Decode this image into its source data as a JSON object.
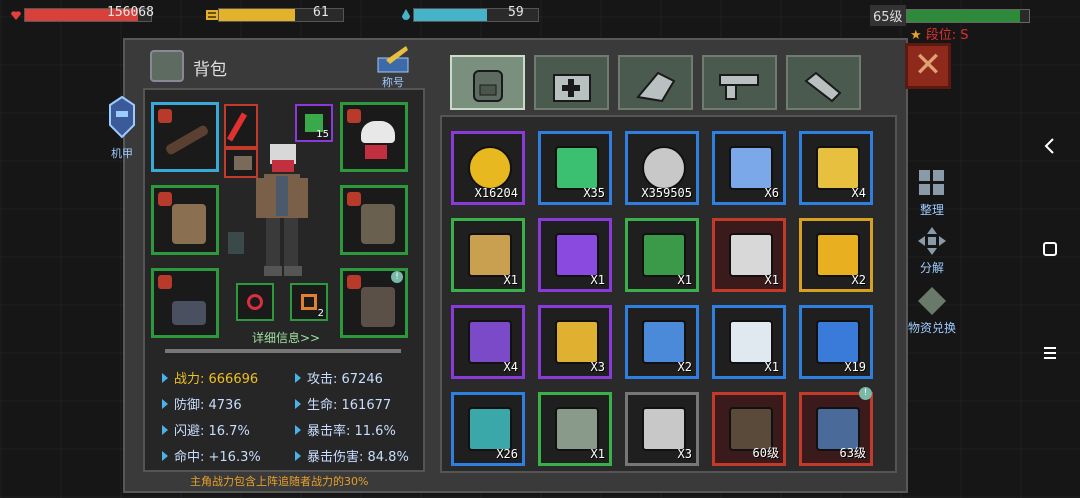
{
  "hud": {
    "hp": "156068",
    "energy": "61",
    "water": "59",
    "level": "65级",
    "rank_label": "段位: S",
    "hp_fraction": 0.9,
    "energy_fraction": 0.61,
    "water_fraction": 0.59,
    "rank_fraction": 0.93
  },
  "panel": {
    "title": "背包",
    "title_badge": "称号",
    "mecha_label": "机甲",
    "detail_link": "详细信息>>",
    "footer_note": "主角战力包含上阵追随者战力的30%"
  },
  "stats": [
    {
      "label": "战力: 666696"
    },
    {
      "label": "攻击: 67246"
    },
    {
      "label": "防御: 4736"
    },
    {
      "label": "生命: 161677"
    },
    {
      "label": "闪避: 16.7%"
    },
    {
      "label": "暴击率: 11.6%"
    },
    {
      "label": "命中: +16.3%"
    },
    {
      "label": "暴击伤害: 84.8%"
    }
  ],
  "tabs": [
    {
      "icon": "backpack-icon"
    },
    {
      "icon": "medkit-icon"
    },
    {
      "icon": "drill-icon"
    },
    {
      "icon": "gun-icon"
    },
    {
      "icon": "wrench-icon"
    }
  ],
  "equipment": {
    "mini_badge_1": "15",
    "mini_badge_2": "2"
  },
  "items": [
    {
      "icon": "gold-coin-icon",
      "count": "X16204",
      "rarity": "purple"
    },
    {
      "icon": "cocktail-icon",
      "count": "X35",
      "rarity": "blue"
    },
    {
      "icon": "silver-coin-icon",
      "count": "X359505",
      "rarity": "blue"
    },
    {
      "icon": "map-icon",
      "count": "X6",
      "rarity": "blue"
    },
    {
      "icon": "exp-card-icon",
      "count": "X4",
      "rarity": "blue"
    },
    {
      "icon": "exp-badge-icon",
      "count": "X1",
      "rarity": "green"
    },
    {
      "icon": "purple-card-icon",
      "count": "X1",
      "rarity": "purple"
    },
    {
      "icon": "green-card-icon",
      "count": "X1",
      "rarity": "green"
    },
    {
      "icon": "red-box-icon",
      "count": "X1",
      "rarity": "red"
    },
    {
      "icon": "gold-box-icon",
      "count": "X2",
      "rarity": "gold"
    },
    {
      "icon": "purple-chest-icon",
      "count": "X4",
      "rarity": "purple"
    },
    {
      "icon": "purple-gold-chest-icon",
      "count": "X3",
      "rarity": "purple"
    },
    {
      "icon": "blue-crate-icon",
      "count": "X2",
      "rarity": "blue"
    },
    {
      "icon": "blue-white-chest-icon",
      "count": "X1",
      "rarity": "blue"
    },
    {
      "icon": "blue-gold-chest-icon",
      "count": "X19",
      "rarity": "blue"
    },
    {
      "icon": "teal-chest-icon",
      "count": "X26",
      "rarity": "blue"
    },
    {
      "icon": "green-chest-icon",
      "count": "X1",
      "rarity": "green"
    },
    {
      "icon": "gray-chest-icon",
      "count": "X3",
      "rarity": "gray"
    },
    {
      "icon": "crossbow-icon",
      "count": "60级",
      "rarity": "red"
    },
    {
      "icon": "jeans-icon",
      "count": "63级",
      "rarity": "red"
    }
  ],
  "side": {
    "sort": "整理",
    "split": "分解",
    "exchange": "物资兑换"
  },
  "colors": {
    "hp": "#d8413a",
    "energy": "#e2b22a",
    "water": "#46b3c9",
    "rank": "#2e8a3a",
    "purple": "#8a3ad8",
    "blue": "#2f7fe0",
    "green": "#3ab04a",
    "red": "#c23a2a",
    "gold": "#d8a020",
    "gray": "#777777"
  }
}
